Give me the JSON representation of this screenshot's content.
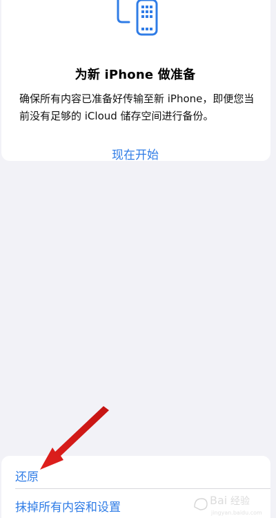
{
  "prepare": {
    "title": "为新 iPhone 做准备",
    "description": "确保所有内容已准备好传输至新 iPhone，即便您当前没有足够的 iCloud 储存空间进行备份。",
    "start_label": "现在开始",
    "icon": "phone-transfer-icon"
  },
  "options": {
    "restore_label": "还原",
    "erase_label": "抹掉所有内容和设置"
  },
  "colors": {
    "accent": "#2f7ce6",
    "background": "#f2f2f7",
    "annotation_arrow": "#e0201e"
  }
}
